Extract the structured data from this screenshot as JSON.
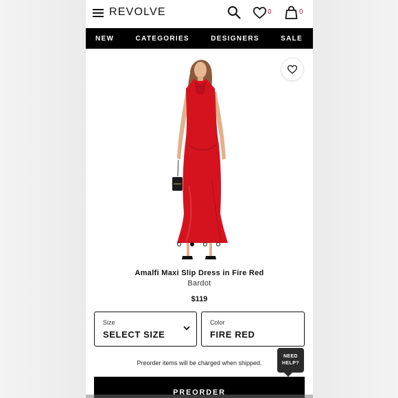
{
  "header": {
    "logo": "REVOLVE",
    "wishlist_count": "0",
    "bag_count": "0",
    "count_color": "#c2185b"
  },
  "nav": {
    "items": [
      "NEW",
      "CATEGORIES",
      "DESIGNERS",
      "SALE"
    ]
  },
  "product": {
    "image": {
      "dress_color": "#d4131f",
      "carousel_total": 4,
      "carousel_active_index": 1
    },
    "title": "Amalfi Maxi Slip Dress in Fire Red",
    "brand": "Bardot",
    "price": "$119"
  },
  "options": {
    "size": {
      "label": "Size",
      "value": "SELECT SIZE"
    },
    "color": {
      "label": "Color",
      "value": "FIRE RED"
    }
  },
  "preorder_note": "Preorder items will be charged when shipped.",
  "help": {
    "line1": "NEED",
    "line2": "HELP?"
  },
  "cta": {
    "label": "PREORDER"
  },
  "icons": [
    "menu-icon",
    "search-icon",
    "heart-icon",
    "bag-icon",
    "chevron-down-icon"
  ]
}
